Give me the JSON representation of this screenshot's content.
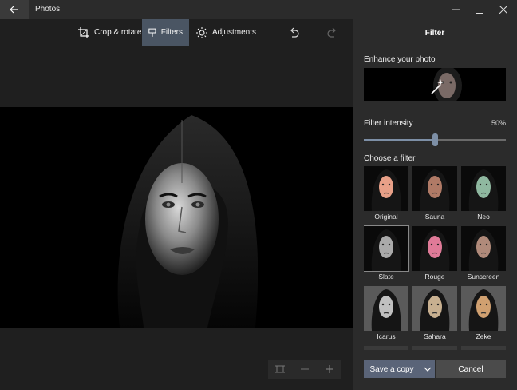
{
  "titlebar": {
    "title": "Photos"
  },
  "toolbar": {
    "crop_label": "Crop & rotate",
    "filters_label": "Filters",
    "adjustments_label": "Adjustments",
    "active_tool": "Filters"
  },
  "panel": {
    "title": "Filter",
    "enhance_label": "Enhance your photo",
    "intensity_label": "Filter intensity",
    "intensity_value": "50%",
    "intensity_fraction": 0.5,
    "choose_label": "Choose a filter",
    "filters": [
      {
        "name": "Original",
        "tint": "#e8a088"
      },
      {
        "name": "Sauna",
        "tint": "#b07a66"
      },
      {
        "name": "Neo",
        "tint": "#8fb8a0"
      },
      {
        "name": "Slate",
        "tint": "#aaaaaa"
      },
      {
        "name": "Rouge",
        "tint": "#e07a98"
      },
      {
        "name": "Sunscreen",
        "tint": "#b08a7a"
      },
      {
        "name": "Icarus",
        "tint": "#c0c0c0"
      },
      {
        "name": "Sahara",
        "tint": "#c8b090"
      },
      {
        "name": "Zeke",
        "tint": "#d0a070"
      }
    ],
    "selected_filter": "Slate",
    "save_label": "Save a copy",
    "cancel_label": "Cancel"
  },
  "colors": {
    "accent": "#5a6478",
    "active_tab": "#4a5563",
    "panel_bg": "#2b2b2b"
  }
}
